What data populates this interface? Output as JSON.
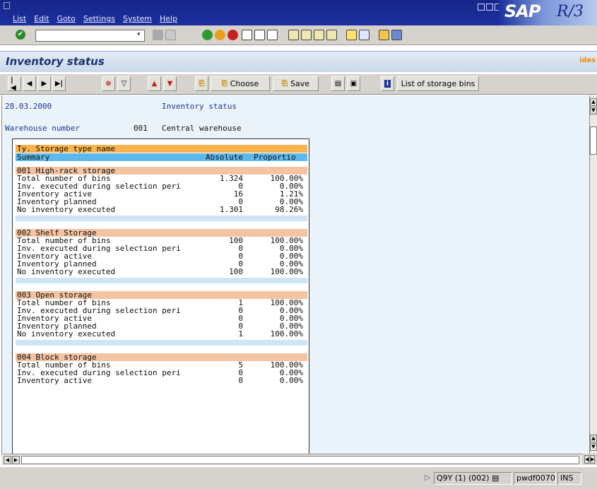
{
  "menu": [
    "List",
    "Edit",
    "Goto",
    "Settings",
    "System",
    "Help"
  ],
  "brand": {
    "logo": "SAP",
    "release": "R/3"
  },
  "command_field": {
    "value": "",
    "placeholder": ""
  },
  "title": "Inventory status",
  "corner_logo": "ides",
  "toolbar": {
    "choose": "Choose",
    "save": "Save",
    "storage_bins": "List of storage bins"
  },
  "report": {
    "date": "28.03.2000",
    "heading": "Inventory status",
    "warehouse_label": "Warehouse number",
    "warehouse_no": "001",
    "warehouse_name": "Central warehouse",
    "col_header1": "Ty. Storage type name",
    "col_header2": "Summary",
    "col_absolute": "Absolute",
    "col_proportion": "Proportio",
    "groups": [
      {
        "name": "001 High-rack storage",
        "rows": [
          {
            "label": "Total number of bins",
            "abs": "1.324",
            "pct": "100.00%"
          },
          {
            "label": "Inv. executed during selection peri",
            "abs": "0",
            "pct": "0.00%"
          },
          {
            "label": "Inventory active",
            "abs": "16",
            "pct": "1.21%"
          },
          {
            "label": "Inventory planned",
            "abs": "0",
            "pct": "0.00%"
          },
          {
            "label": "No inventory executed",
            "abs": "1.301",
            "pct": "98.26%"
          }
        ]
      },
      {
        "name": "002 Shelf Storage",
        "rows": [
          {
            "label": "Total number of bins",
            "abs": "100",
            "pct": "100.00%"
          },
          {
            "label": "Inv. executed during selection peri",
            "abs": "0",
            "pct": "0.00%"
          },
          {
            "label": "Inventory active",
            "abs": "0",
            "pct": "0.00%"
          },
          {
            "label": "Inventory planned",
            "abs": "0",
            "pct": "0.00%"
          },
          {
            "label": "No inventory executed",
            "abs": "100",
            "pct": "100.00%"
          }
        ]
      },
      {
        "name": "003 Open storage",
        "rows": [
          {
            "label": "Total number of bins",
            "abs": "1",
            "pct": "100.00%"
          },
          {
            "label": "Inv. executed during selection peri",
            "abs": "0",
            "pct": "0.00%"
          },
          {
            "label": "Inventory active",
            "abs": "0",
            "pct": "0.00%"
          },
          {
            "label": "Inventory planned",
            "abs": "0",
            "pct": "0.00%"
          },
          {
            "label": "No inventory executed",
            "abs": "1",
            "pct": "100.00%"
          }
        ]
      },
      {
        "name": "004 Block storage",
        "rows": [
          {
            "label": "Total number of bins",
            "abs": "5",
            "pct": "100.00%"
          },
          {
            "label": "Inv. executed during selection peri",
            "abs": "0",
            "pct": "0.00%"
          },
          {
            "label": "Inventory active",
            "abs": "0",
            "pct": "0.00%"
          }
        ]
      }
    ]
  },
  "status": {
    "system": "Q9Y (1) (002)",
    "server": "pwdf0070",
    "mode": "INS"
  }
}
